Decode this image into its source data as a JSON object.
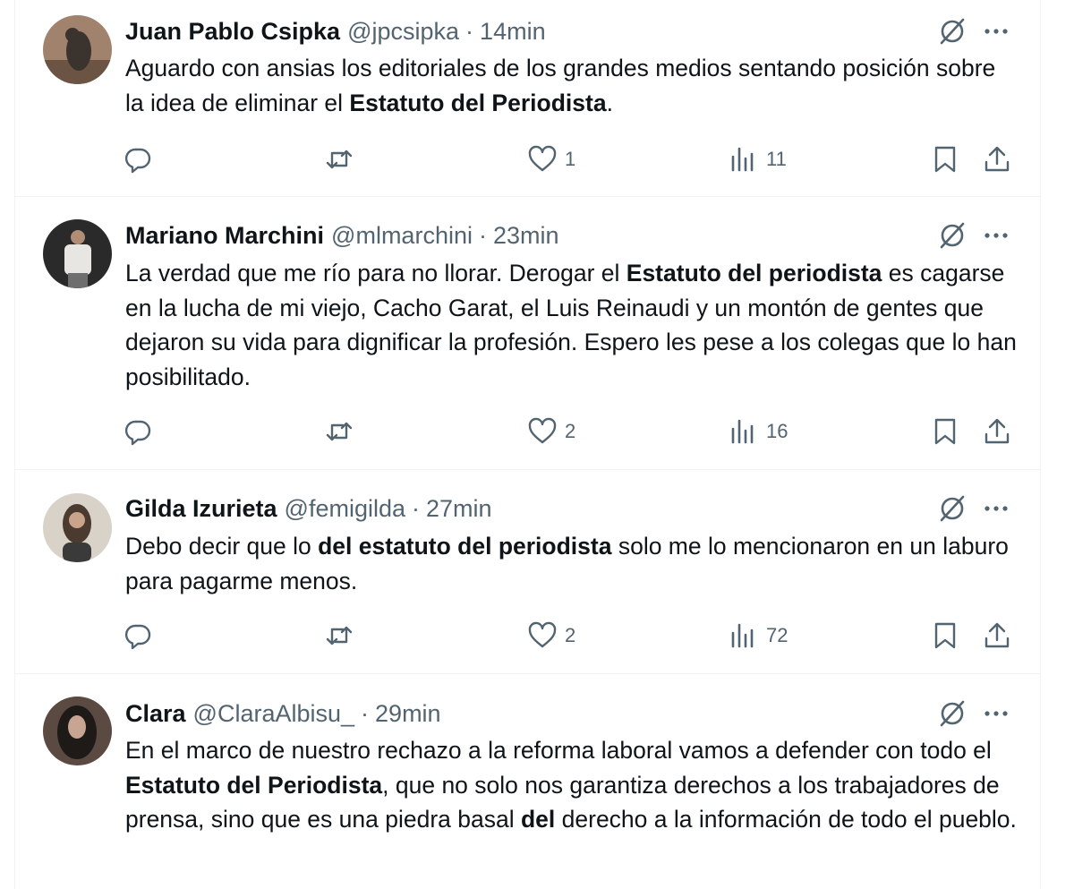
{
  "tweets": [
    {
      "name": "Juan Pablo Csipka",
      "handle": "@jpcsipka",
      "sep": "·",
      "time": "14min",
      "text": [
        {
          "t": "Aguardo con ansias los editoriales de los grandes medios sentando posición sobre la idea de eliminar el ",
          "b": false
        },
        {
          "t": "Estatuto del Periodista",
          "b": true
        },
        {
          "t": ".",
          "b": false
        }
      ],
      "likes": "1",
      "views": "11",
      "avatar_colors": [
        "#8a6e5a",
        "#3b332d"
      ]
    },
    {
      "name": "Mariano Marchini",
      "handle": "@mlmarchini",
      "sep": "·",
      "time": "23min",
      "text": [
        {
          "t": "La verdad que me río para no llorar. Derogar el ",
          "b": false
        },
        {
          "t": "Estatuto del periodista",
          "b": true
        },
        {
          "t": " es cagarse en la lucha de mi viejo, Cacho Garat, el Luis Reinaudi y un montón de gentes que dejaron su vida para dignificar la profesión. Espero les pese a los colegas que lo han posibilitado.",
          "b": false
        }
      ],
      "likes": "2",
      "views": "16",
      "avatar_colors": [
        "#2a2a2a",
        "#c9c6c0"
      ]
    },
    {
      "name": "Gilda Izurieta",
      "handle": "@femigilda",
      "sep": "·",
      "time": "27min",
      "text": [
        {
          "t": "Debo decir que lo ",
          "b": false
        },
        {
          "t": "del estatuto del periodista",
          "b": true
        },
        {
          "t": " solo me lo mencionaron en un laburo para pagarme menos.",
          "b": false
        }
      ],
      "likes": "2",
      "views": "72",
      "avatar_colors": [
        "#d8d2c8",
        "#4a3a30"
      ]
    },
    {
      "name": "Clara",
      "handle": "@ClaraAlbisu_",
      "sep": "·",
      "time": "29min",
      "text": [
        {
          "t": "En el marco de nuestro rechazo a la reforma laboral vamos a defender con todo el ",
          "b": false
        },
        {
          "t": "Estatuto del Periodista",
          "b": true
        },
        {
          "t": ", que no solo nos garantiza derechos a los trabajadores de prensa, sino que es una piedra basal ",
          "b": false
        },
        {
          "t": "del",
          "b": true
        },
        {
          "t": " derecho a la información de todo el pueblo.",
          "b": false
        }
      ],
      "likes": "",
      "views": "",
      "avatar_colors": [
        "#5a4a42",
        "#1e1a18"
      ]
    }
  ],
  "icons": {
    "reply": "reply-icon",
    "retweet": "retweet-icon",
    "like": "heart-icon",
    "views": "views-icon",
    "bookmark": "bookmark-icon",
    "share": "share-icon",
    "grok": "grok-icon",
    "more": "more-icon"
  },
  "colors": {
    "text": "#0f1419",
    "secondary": "#536471",
    "border": "#eff3f4"
  }
}
